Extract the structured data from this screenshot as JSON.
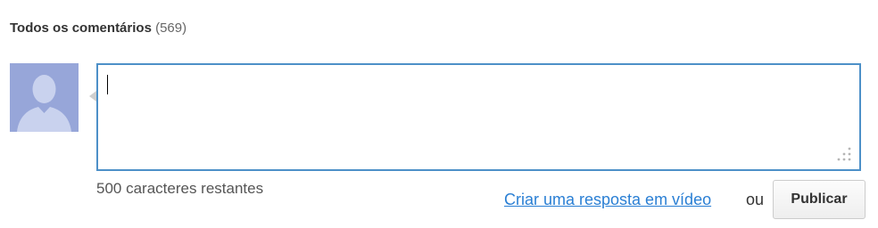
{
  "comments": {
    "title": "Todos os comentários",
    "count": "(569)"
  },
  "composer": {
    "placeholder": "",
    "value": "",
    "remaining_text": "500 caracteres restantes"
  },
  "actions": {
    "video_response_link": "Criar uma resposta em vídeo",
    "or_text": "ou",
    "publish_label": "Publicar"
  },
  "colors": {
    "avatar_bg": "#97a6d9",
    "box_border": "#4d90c8",
    "link": "#2a7fd4"
  },
  "icons": {
    "avatar": "user-silhouette-icon",
    "resize": "resize-grip-icon"
  }
}
